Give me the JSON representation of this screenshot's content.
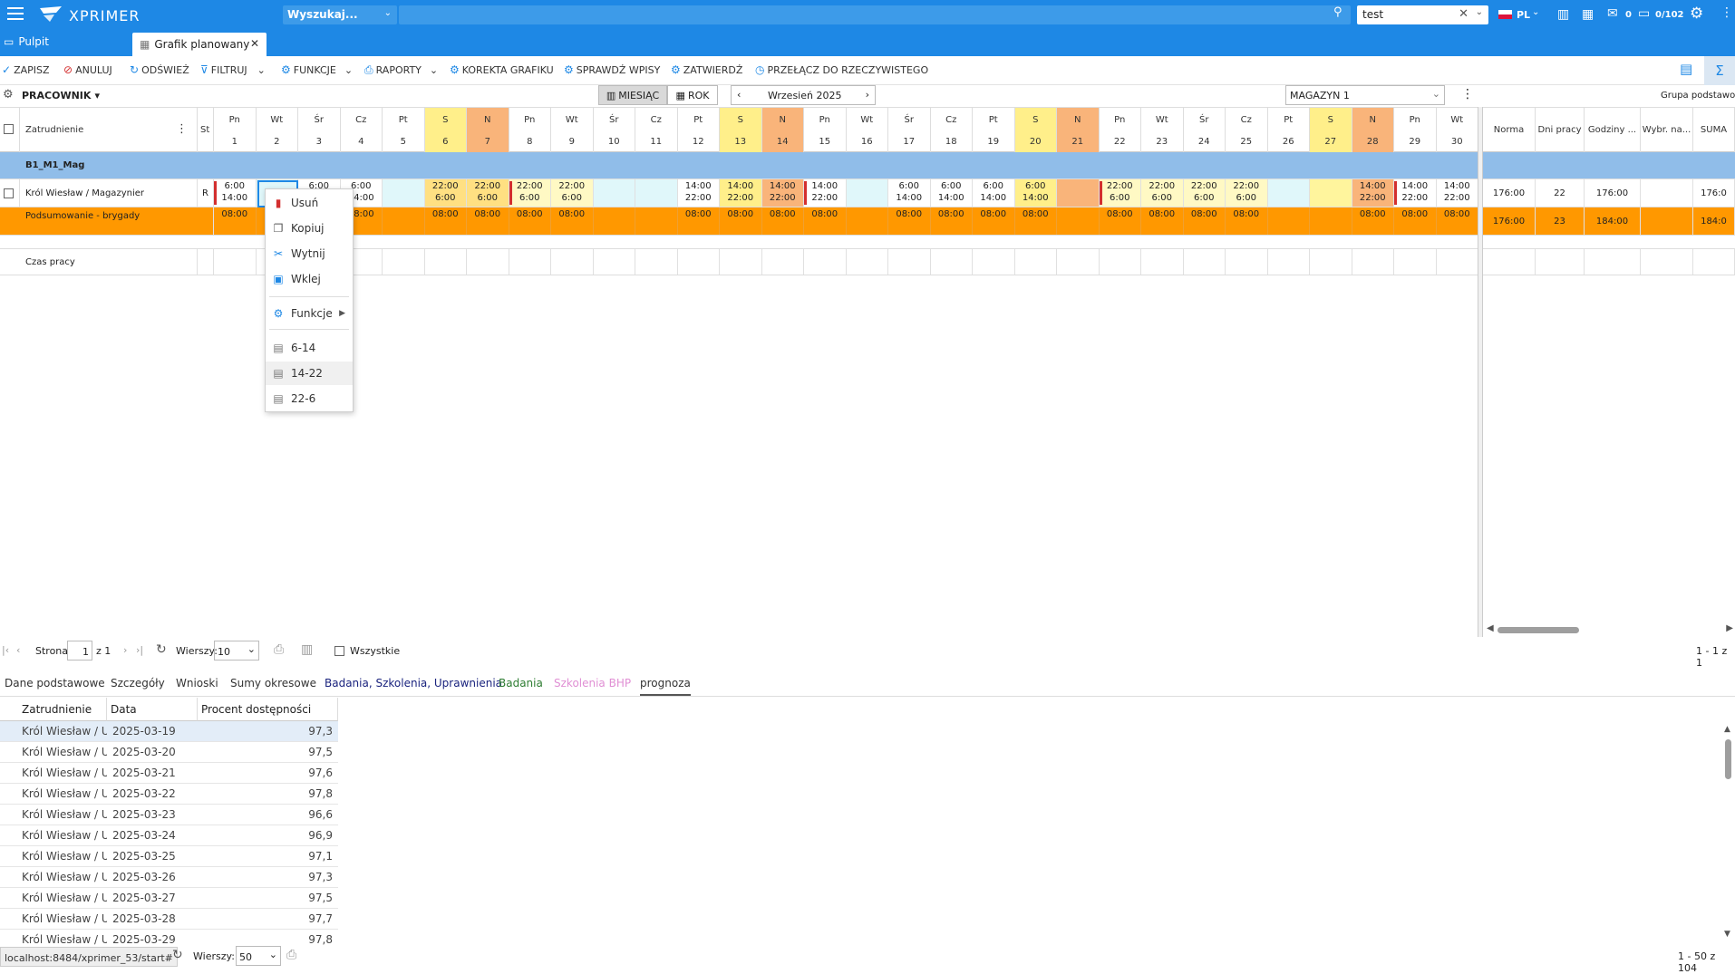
{
  "app": {
    "brand": "XPRIMER",
    "search_placeholder": "Wyszukaj...",
    "search_value": "test",
    "lang": "PL",
    "mail_count": "0",
    "msg_count": "0/102"
  },
  "tabs": [
    {
      "label": "Pulpit"
    },
    {
      "label": "Grafik planowany"
    }
  ],
  "toolbar": [
    "ZAPISZ",
    "ANULUJ",
    "ODŚWIEŻ",
    "FILTRUJ",
    "FUNKCJE",
    "RAPORTY",
    "KOREKTA GRAFIKU",
    "SPRAWDŹ WPISY",
    "ZATWIERDŹ",
    "PRZEŁĄCZ DO RZECZYWISTEGO"
  ],
  "nav": {
    "group_label": "PRACOWNIK",
    "view_month": "MIESIĄC",
    "view_year": "ROK",
    "period": "Wrzesień 2025",
    "warehouse": "MAGAZYN 1",
    "right_label": "Grupa podstawowa"
  },
  "grid": {
    "col_employee": "Zatrudnienie",
    "col_st": "St",
    "days": [
      {
        "w": "Pn",
        "d": "1"
      },
      {
        "w": "Wt",
        "d": "2"
      },
      {
        "w": "Śr",
        "d": "3"
      },
      {
        "w": "Cz",
        "d": "4"
      },
      {
        "w": "Pt",
        "d": "5"
      },
      {
        "w": "S",
        "d": "6"
      },
      {
        "w": "N",
        "d": "7"
      },
      {
        "w": "Pn",
        "d": "8"
      },
      {
        "w": "Wt",
        "d": "9"
      },
      {
        "w": "Śr",
        "d": "10"
      },
      {
        "w": "Cz",
        "d": "11"
      },
      {
        "w": "Pt",
        "d": "12"
      },
      {
        "w": "S",
        "d": "13"
      },
      {
        "w": "N",
        "d": "14"
      },
      {
        "w": "Pn",
        "d": "15"
      },
      {
        "w": "Wt",
        "d": "16"
      },
      {
        "w": "Śr",
        "d": "17"
      },
      {
        "w": "Cz",
        "d": "18"
      },
      {
        "w": "Pt",
        "d": "19"
      },
      {
        "w": "S",
        "d": "20"
      },
      {
        "w": "N",
        "d": "21"
      },
      {
        "w": "Pn",
        "d": "22"
      },
      {
        "w": "Wt",
        "d": "23"
      },
      {
        "w": "Śr",
        "d": "24"
      },
      {
        "w": "Cz",
        "d": "25"
      },
      {
        "w": "Pt",
        "d": "26"
      },
      {
        "w": "S",
        "d": "27"
      },
      {
        "w": "N",
        "d": "28"
      },
      {
        "w": "Pn",
        "d": "29"
      },
      {
        "w": "Wt",
        "d": "30"
      }
    ],
    "right_cols": [
      "Norma",
      "Dni pracy",
      "Godziny ...",
      "Wybr. na...",
      "SUMA"
    ],
    "group_name": "B1_M1_Mag",
    "employee": {
      "name": "Król Wiesław / Magazynier",
      "st": "R",
      "shifts": [
        [
          "6:00",
          "14:00"
        ],
        [
          "",
          ""
        ],
        [
          "6:00",
          ""
        ],
        [
          "6:00",
          "14:00"
        ],
        [
          "",
          ""
        ],
        [
          "22:00",
          "6:00"
        ],
        [
          "22:00",
          "6:00"
        ],
        [
          "22:00",
          "6:00"
        ],
        [
          "22:00",
          "6:00"
        ],
        [
          "",
          ""
        ],
        [
          "",
          ""
        ],
        [
          "14:00",
          "22:00"
        ],
        [
          "14:00",
          "22:00"
        ],
        [
          "14:00",
          "22:00"
        ],
        [
          "14:00",
          "22:00"
        ],
        [
          "",
          ""
        ],
        [
          "6:00",
          "14:00"
        ],
        [
          "6:00",
          "14:00"
        ],
        [
          "6:00",
          "14:00"
        ],
        [
          "6:00",
          "14:00"
        ],
        [
          "",
          ""
        ],
        [
          "22:00",
          "6:00"
        ],
        [
          "22:00",
          "6:00"
        ],
        [
          "22:00",
          "6:00"
        ],
        [
          "22:00",
          "6:00"
        ],
        [
          "",
          ""
        ],
        [
          "",
          ""
        ],
        [
          "14:00",
          "22:00"
        ],
        [
          "14:00",
          "22:00"
        ],
        [
          "14:00",
          "22:00"
        ]
      ],
      "norma": "176:00",
      "dni": "22",
      "godziny": "176:00",
      "wybr": "",
      "suma": "176:0"
    },
    "summary": {
      "label": "Podsumowanie - brygady",
      "values": [
        "08:00",
        "",
        "08:00",
        "08:00",
        "",
        "08:00",
        "08:00",
        "08:00",
        "08:00",
        "",
        "",
        "08:00",
        "08:00",
        "08:00",
        "08:00",
        "",
        "08:00",
        "08:00",
        "08:00",
        "08:00",
        "",
        "08:00",
        "08:00",
        "08:00",
        "08:00",
        "",
        "",
        "08:00",
        "08:00",
        "08:00"
      ],
      "norma": "176:00",
      "dni": "23",
      "godziny": "184:00",
      "wybr": "",
      "suma": "184:0"
    },
    "worktime_label": "Czas pracy"
  },
  "context_menu": [
    {
      "label": "Usuń",
      "icon": "trash-icon"
    },
    {
      "label": "Kopiuj",
      "icon": "copy-icon"
    },
    {
      "label": "Wytnij",
      "icon": "scissors-icon"
    },
    {
      "label": "Wklej",
      "icon": "paste-icon"
    },
    {
      "label": "Funkcje",
      "icon": "functions-icon"
    },
    {
      "label": "6-14",
      "icon": "template-icon"
    },
    {
      "label": "14-22",
      "icon": "template-icon"
    },
    {
      "label": "22-6",
      "icon": "template-icon"
    }
  ],
  "pager": {
    "page_label": "Strona",
    "page": "1",
    "of": "z 1",
    "rows_label": "Wierszy:",
    "rows": "10",
    "all_label": "Wszystkie",
    "range": "1 - 1 z 1"
  },
  "subtabs": [
    "Dane podstawowe",
    "Szczegóły",
    "Wnioski",
    "Sumy okresowe",
    "Badania, Szkolenia, Uprawnienia",
    "Badania",
    "Szkolenia BHP",
    "prognoza"
  ],
  "subgrid": {
    "headers": [
      "Zatrudnienie",
      "Data",
      "Procent dostępności"
    ],
    "rows": [
      {
        "emp": "Król Wiesław / UF",
        "date": "2025-03-19",
        "pct": "97,3"
      },
      {
        "emp": "Król Wiesław / UF",
        "date": "2025-03-20",
        "pct": "97,5"
      },
      {
        "emp": "Król Wiesław / UF",
        "date": "2025-03-21",
        "pct": "97,6"
      },
      {
        "emp": "Król Wiesław / UF",
        "date": "2025-03-22",
        "pct": "97,8"
      },
      {
        "emp": "Król Wiesław / UF",
        "date": "2025-03-23",
        "pct": "96,6"
      },
      {
        "emp": "Król Wiesław / UF",
        "date": "2025-03-24",
        "pct": "96,9"
      },
      {
        "emp": "Król Wiesław / UF",
        "date": "2025-03-25",
        "pct": "97,1"
      },
      {
        "emp": "Król Wiesław / UF",
        "date": "2025-03-26",
        "pct": "97,3"
      },
      {
        "emp": "Król Wiesław / UF",
        "date": "2025-03-27",
        "pct": "97,5"
      },
      {
        "emp": "Król Wiesław / UF",
        "date": "2025-03-28",
        "pct": "97,7"
      },
      {
        "emp": "Król Wiesław / UF",
        "date": "2025-03-29",
        "pct": "97,8"
      }
    ]
  },
  "bottom": {
    "url": "localhost:8484/xprimer_53/start#",
    "rows_label": "Wierszy:",
    "rows": "50",
    "range": "1 - 50 z 104"
  }
}
